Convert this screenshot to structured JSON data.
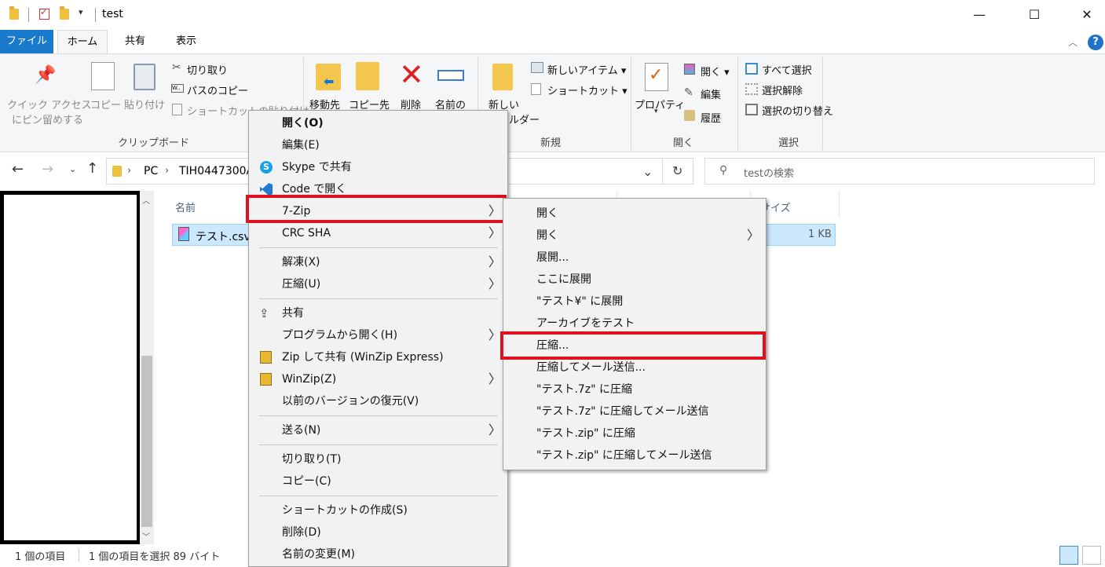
{
  "window": {
    "title": "test",
    "controls": {
      "minimize": "—",
      "maximize": "☐",
      "close": "✕"
    }
  },
  "tabs": {
    "file": "ファイル",
    "home": "ホーム",
    "share": "共有",
    "view": "表示"
  },
  "ribbon": {
    "pin_l1": "クイック アクセス",
    "pin_l2": "にピン留めする",
    "copy": "コピー",
    "paste": "貼り付け",
    "cut": "切り取り",
    "copy_path": "パスのコピー",
    "paste_shortcut": "ショートカットの貼り付け",
    "group_clipboard": "クリップボード",
    "move_to": "移動先",
    "copy_to": "コピー先",
    "delete": "削除",
    "rename": "名前の",
    "new_folder_l1": "新しい",
    "new_folder_l2": "フォルダー",
    "new_item": "新しいアイテム ▾",
    "shortcut": "ショートカット ▾",
    "group_new": "新規",
    "properties": "プロパティ",
    "open": "開く ▾",
    "edit": "編集",
    "history": "履歴",
    "group_open": "開く",
    "select_all": "すべて選択",
    "select_none": "選択解除",
    "invert_selection": "選択の切り替え",
    "group_select": "選択"
  },
  "address": {
    "path_pc": "PC",
    "path_drive": "TIH0447300A",
    "search_placeholder": "testの検索"
  },
  "list": {
    "col_name": "名前",
    "col_size": "サイズ",
    "files": [
      {
        "name": "テスト.csv",
        "size": "1 KB"
      }
    ]
  },
  "status": {
    "count": "1 個の項目",
    "selected": "1 個の項目を選択  89 バイト"
  },
  "context_menu": {
    "items": [
      "開く(O)",
      "編集(E)",
      "Skype で共有",
      "Code で開く",
      "7-Zip",
      "CRC SHA",
      "解凍(X)",
      "圧縮(U)",
      "共有",
      "プログラムから開く(H)",
      "Zip して共有 (WinZip Express)",
      "WinZip(Z)",
      "以前のバージョンの復元(V)",
      "送る(N)",
      "切り取り(T)",
      "コピー(C)",
      "ショートカットの作成(S)",
      "削除(D)",
      "名前の変更(M)"
    ]
  },
  "submenu_7zip": {
    "items": [
      "開く",
      "開く",
      "展開...",
      "ここに展開",
      "\"テスト¥\" に展開",
      "アーカイブをテスト",
      "圧縮...",
      "圧縮してメール送信...",
      "\"テスト.7z\" に圧縮",
      "\"テスト.7z\" に圧縮してメール送信",
      "\"テスト.zip\" に圧縮",
      "\"テスト.zip\" に圧縮してメール送信"
    ]
  },
  "colors": {
    "highlight": "#e0101e",
    "accent": "#1979ca",
    "selection": "#cce8ff"
  }
}
